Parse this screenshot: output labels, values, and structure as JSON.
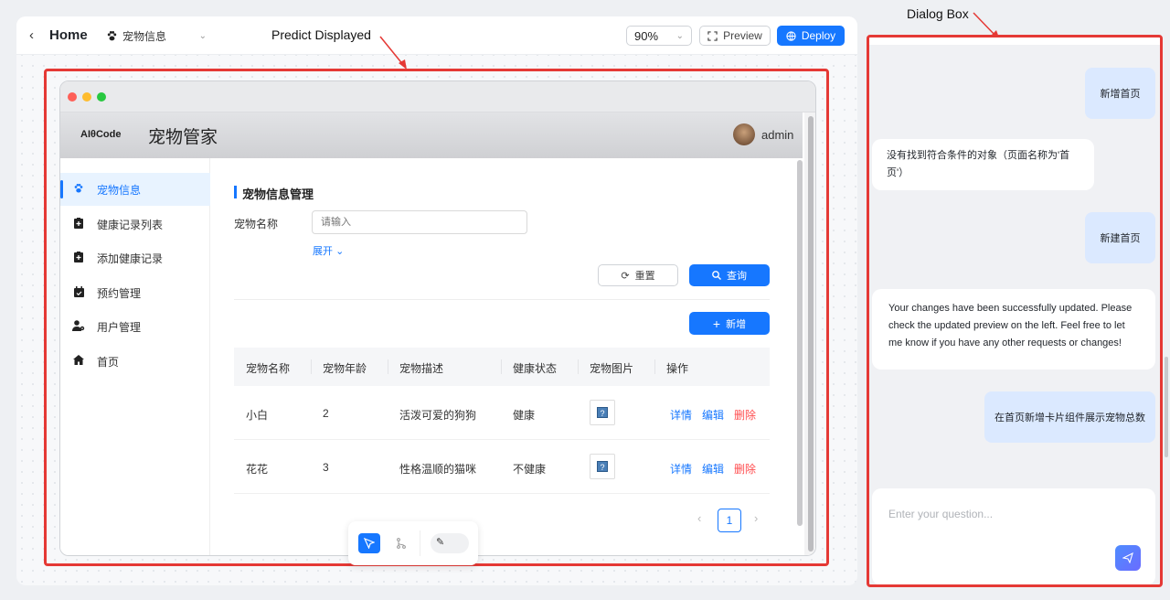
{
  "topbar": {
    "back_label": "Home",
    "page_selector": "宠物信息",
    "zoom": "90%",
    "preview_label": "Preview",
    "deploy_label": "Deploy"
  },
  "annotations": {
    "predict": "Predict Displayed",
    "dialog": "Dialog Box"
  },
  "app": {
    "logo": "AIθCode",
    "title": "宠物管家",
    "user": "admin",
    "sidebar": [
      {
        "label": "宠物信息",
        "icon": "paw-icon",
        "active": true
      },
      {
        "label": "健康记录列表",
        "icon": "clipboard-icon",
        "active": false
      },
      {
        "label": "添加健康记录",
        "icon": "clipboard-add-icon",
        "active": false
      },
      {
        "label": "预约管理",
        "icon": "calendar-icon",
        "active": false
      },
      {
        "label": "用户管理",
        "icon": "user-gear-icon",
        "active": false
      },
      {
        "label": "首页",
        "icon": "home-icon",
        "active": false
      }
    ],
    "section_title": "宠物信息管理",
    "filter_label": "宠物名称",
    "filter_placeholder": "请输入",
    "expand_label": "展开",
    "reset_label": "重置",
    "query_label": "查询",
    "add_label": "新增",
    "columns": [
      "宠物名称",
      "宠物年龄",
      "宠物描述",
      "健康状态",
      "宠物图片",
      "操作"
    ],
    "rows": [
      {
        "name": "小白",
        "age": "2",
        "desc": "活泼可爱的狗狗",
        "health": "健康"
      },
      {
        "name": "花花",
        "age": "3",
        "desc": "性格温顺的猫咪",
        "health": "不健康"
      }
    ],
    "actions": {
      "detail": "详情",
      "edit": "编辑",
      "delete": "删除"
    },
    "page": "1"
  },
  "chat": {
    "messages": [
      {
        "role": "user",
        "text": "新增首页"
      },
      {
        "role": "bot",
        "text": "没有找到符合条件的对象（页面名称为'首页'）"
      },
      {
        "role": "user",
        "text": "新建首页"
      },
      {
        "role": "bot",
        "text": "Your changes have been successfully updated. Please check the updated preview on the left. Feel free to let me know if you have any other requests or changes!"
      },
      {
        "role": "user",
        "text": "在首页新增卡片组件展示宠物总数"
      }
    ],
    "input_placeholder": "Enter your question..."
  },
  "colors": {
    "accent": "#1677ff",
    "frame": "#e53935",
    "danger": "#ff4d4f"
  }
}
